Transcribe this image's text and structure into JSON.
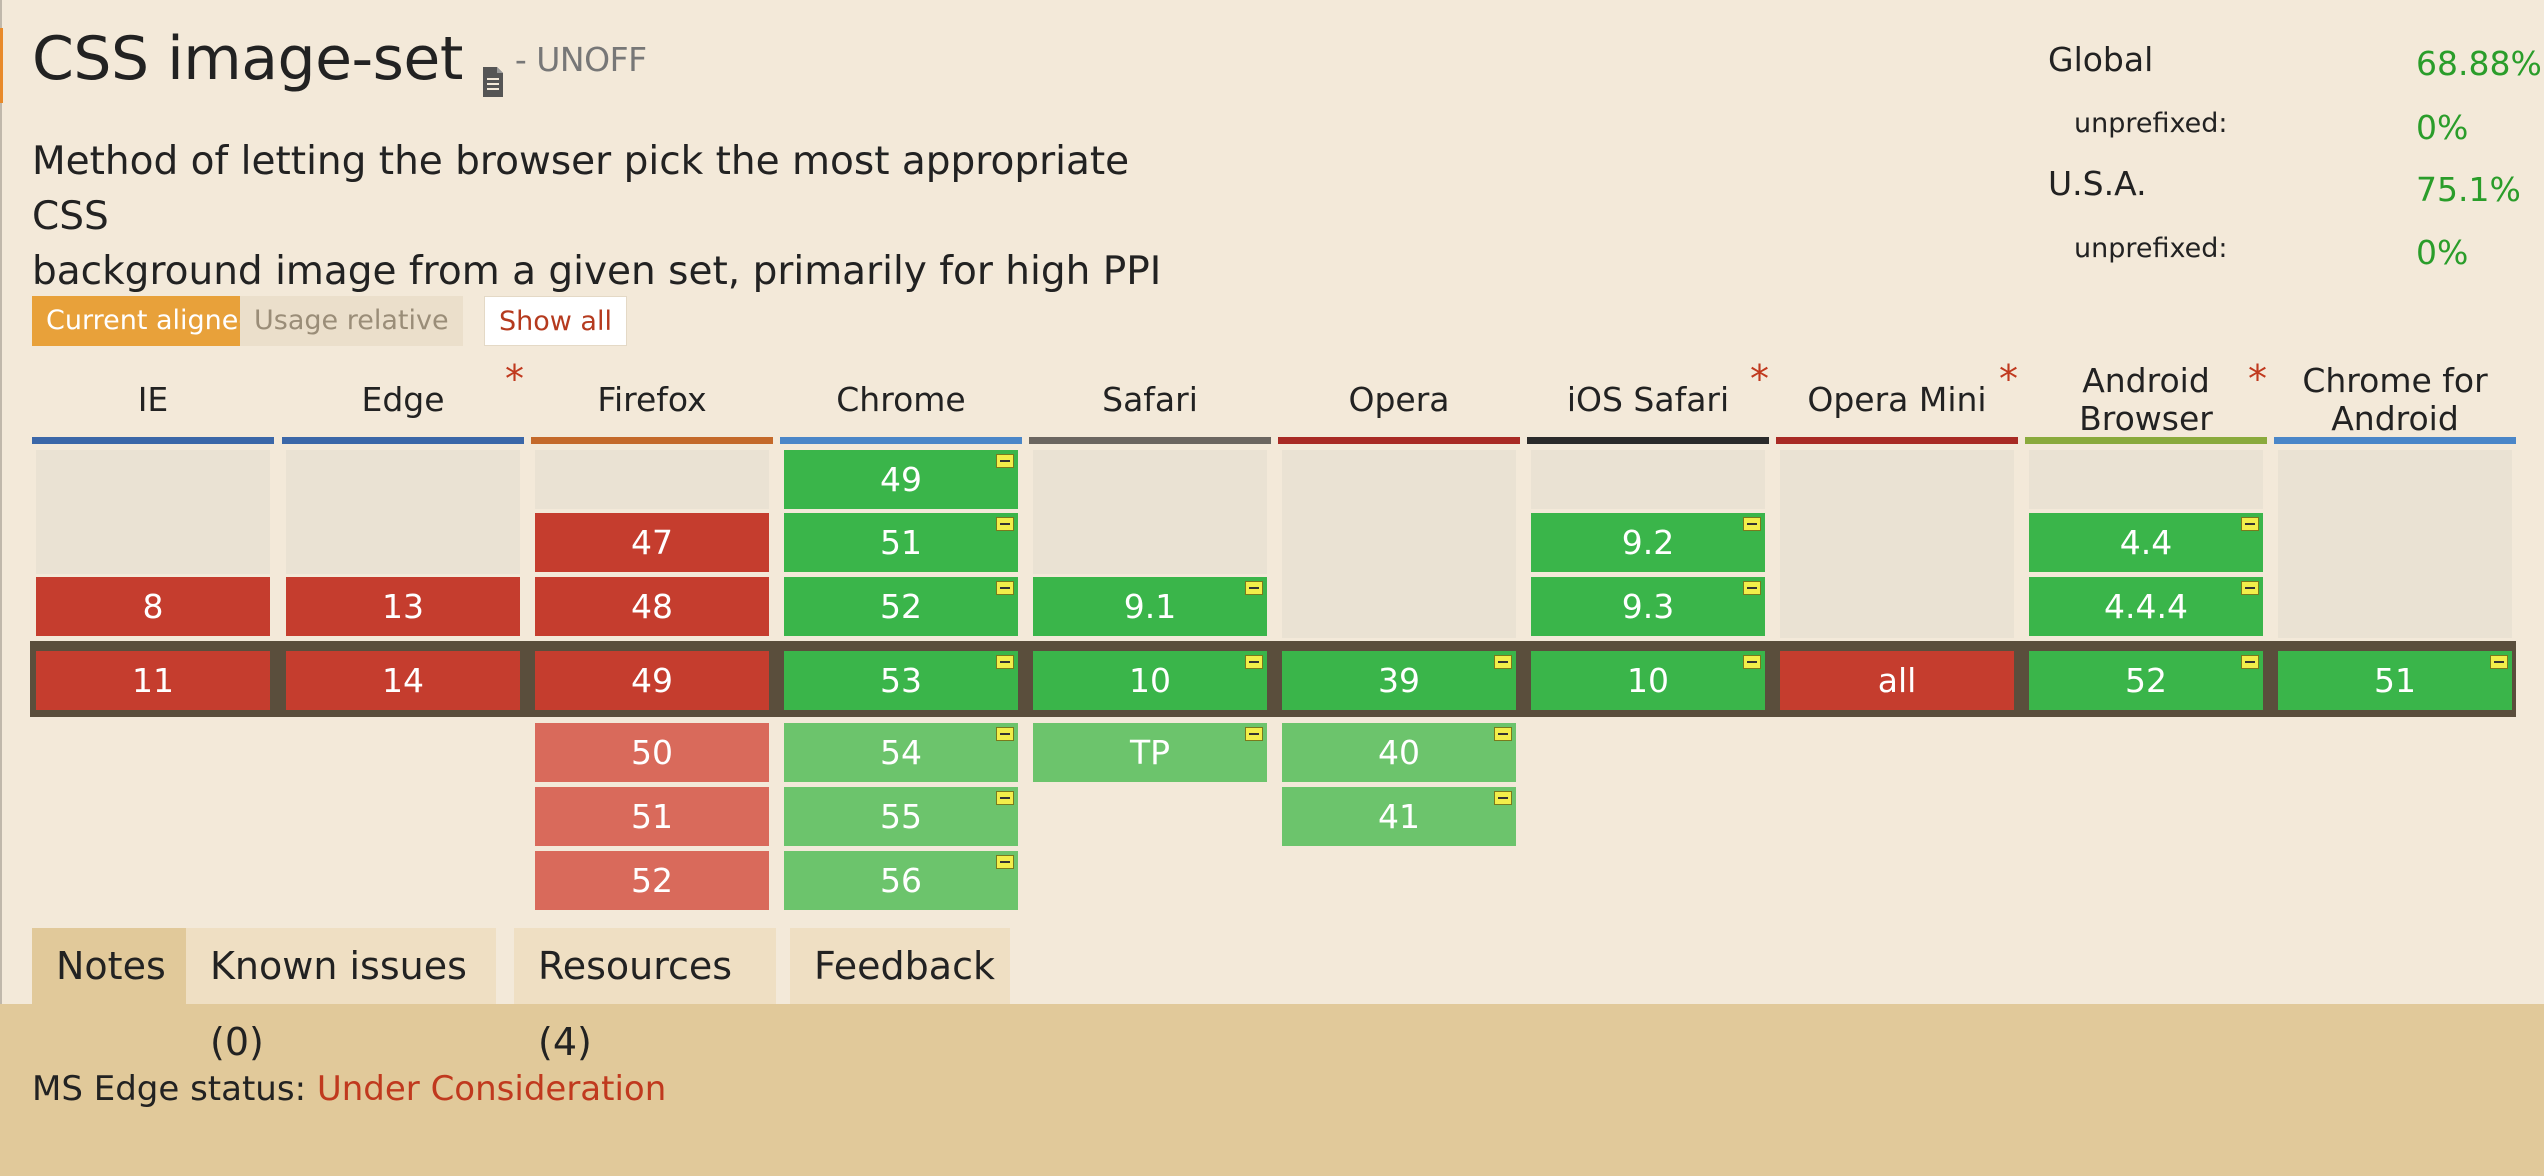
{
  "page": {
    "title": "CSS image-set",
    "status": "- UNOFF",
    "description_line1": "Method of letting the browser pick the most appropriate CSS",
    "description_line2": "background image from a given set, primarily for high PPI screens."
  },
  "stats": {
    "global_label": "Global",
    "global_value": "68.88%",
    "global_unprefixed_label": "unprefixed:",
    "global_unprefixed_value": "0%",
    "usa_label": "U.S.A.",
    "usa_value": "75.1%",
    "usa_unprefixed_label": "unprefixed:",
    "usa_unprefixed_value": "0%"
  },
  "controls": {
    "current_aligned": "Current aligned",
    "usage_relative": "Usage relative",
    "show_all": "Show all"
  },
  "browsers": [
    {
      "line1": "IE",
      "line2": "",
      "star": "",
      "color": "#3b67a8"
    },
    {
      "line1": "Edge",
      "line2": "",
      "star": "*",
      "color": "#3b67a8"
    },
    {
      "line1": "Firefox",
      "line2": "",
      "star": "",
      "color": "#c4692a"
    },
    {
      "line1": "Chrome",
      "line2": "",
      "star": "",
      "color": "#4a86c8"
    },
    {
      "line1": "Safari",
      "line2": "",
      "star": "",
      "color": "#6b6660"
    },
    {
      "line1": "Opera",
      "line2": "",
      "star": "",
      "color": "#a82a24"
    },
    {
      "line1": "iOS Safari",
      "line2": "",
      "star": "*",
      "color": "#2b2b2b"
    },
    {
      "line1": "Opera Mini",
      "line2": "",
      "star": "*",
      "color": "#a82a24"
    },
    {
      "line1": "Android",
      "line2": "Browser",
      "star": "*",
      "color": "#8aaa3c"
    },
    {
      "line1": "Chrome for",
      "line2": "Android",
      "star": "",
      "color": "#4a86c8"
    }
  ],
  "versions": {
    "ie": {
      "r1": "",
      "r2": "",
      "r3": "8",
      "current": "11"
    },
    "edge": {
      "r1": "",
      "r2": "",
      "r3": "13",
      "current": "14"
    },
    "firefox": {
      "r2": "47",
      "r3": "48",
      "current": "49",
      "f1": "50",
      "f2": "51",
      "f3": "52"
    },
    "chrome": {
      "r1": "49",
      "r2": "51",
      "r3": "52",
      "current": "53",
      "f1": "54",
      "f2": "55",
      "f3": "56"
    },
    "safari": {
      "r3": "9.1",
      "current": "10",
      "f1": "TP"
    },
    "opera": {
      "current": "39",
      "f1": "40",
      "f2": "41"
    },
    "ios": {
      "r2": "9.2",
      "r3": "9.3",
      "current": "10"
    },
    "operamini": {
      "current": "all"
    },
    "android": {
      "r2": "4.4",
      "r3": "4.4.4",
      "current": "52"
    },
    "chromeandroid": {
      "current": "51"
    }
  },
  "tabs": {
    "notes": "Notes",
    "known_issues": "Known issues (0)",
    "resources": "Resources (4)",
    "feedback": "Feedback"
  },
  "notes": {
    "label": "MS Edge status: ",
    "link": "Under Consideration"
  }
}
